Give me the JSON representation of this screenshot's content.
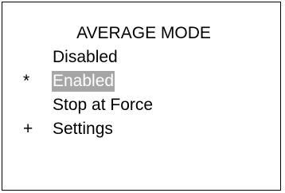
{
  "screen": {
    "title": "AVERAGE MODE",
    "items": [
      {
        "marker": "",
        "label": "Disabled",
        "selected": false
      },
      {
        "marker": "*",
        "label": "Enabled",
        "selected": true
      },
      {
        "marker": "",
        "label": "Stop at Force",
        "selected": false
      },
      {
        "marker": "+",
        "label": "Settings",
        "selected": false
      }
    ]
  },
  "colors": {
    "border": "#000000",
    "text": "#000000",
    "highlight_bg": "#a6a6a6",
    "highlight_text": "#ffffff"
  }
}
